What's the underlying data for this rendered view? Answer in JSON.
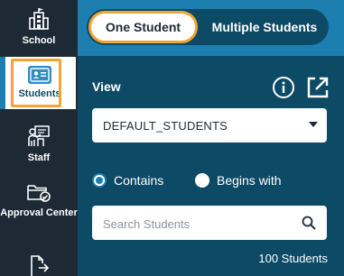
{
  "sidebar": {
    "items": [
      {
        "label": "School",
        "icon": "school-building-icon"
      },
      {
        "label": "Students",
        "icon": "student-id-card-icon",
        "selected": true
      },
      {
        "label": "Staff",
        "icon": "staff-presenter-icon"
      },
      {
        "label": "Approval Center",
        "icon": "folder-check-icon"
      },
      {
        "label": "",
        "icon": "document-export-icon"
      }
    ]
  },
  "mode_toggle": {
    "options": [
      "One Student",
      "Multiple Students"
    ],
    "selected": "One Student"
  },
  "view": {
    "label": "View",
    "selected_value": "DEFAULT_STUDENTS"
  },
  "match_mode": {
    "options": [
      "Contains",
      "Begins with"
    ],
    "selected": "Contains"
  },
  "search": {
    "placeholder": "Search Students"
  },
  "result_count": "100 Students",
  "colors": {
    "sidebar_bg": "#1d2a36",
    "panel_bg": "#0d4a66",
    "header_bg": "#1d7fb0",
    "highlight": "#f3a531"
  }
}
